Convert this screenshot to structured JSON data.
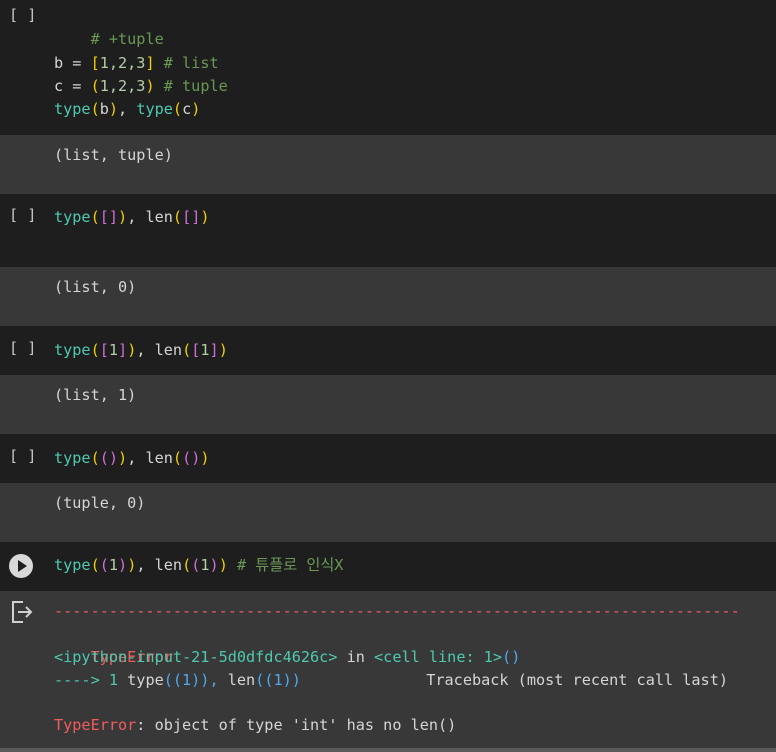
{
  "cells": {
    "c1": {
      "gutter": "[ ]",
      "l1": "# +tuple",
      "l2_a": "b = ",
      "l2_b": "[",
      "l2_c": "1,2,3",
      "l2_d": "]",
      "l2_e": " # list",
      "l3_a": "c = ",
      "l3_b": "(",
      "l3_c": "1,2,3",
      "l3_d": ")",
      "l3_e": " # tuple",
      "l4_a": "type",
      "l4_b": "(",
      "l4_c": "b",
      "l4_d": ")",
      "l4_e": ", ",
      "l4_f": "type",
      "l4_g": "(",
      "l4_h": "c",
      "l4_i": ")",
      "output": "(list, tuple)"
    },
    "c2": {
      "gutter": "[ ]",
      "a": "type",
      "b": "(",
      "c": "[]",
      "d": ")",
      "e": ", len",
      "f": "(",
      "g": "[]",
      "h": ")",
      "output": "(list, 0)"
    },
    "c3": {
      "gutter": "[ ]",
      "a": "type",
      "b": "(",
      "c": "[",
      "d": "1",
      "e": "]",
      "f": ")",
      "g": ", len",
      "h": "(",
      "i": "[",
      "j": "1",
      "k": "]",
      "l": ")",
      "output": "(list, 1)"
    },
    "c4": {
      "gutter": "[ ]",
      "a": "type",
      "b": "(",
      "c": "()",
      "d": ")",
      "e": ", len",
      "f": "(",
      "g": "()",
      "h": ")",
      "output": "(tuple, 0)"
    },
    "c5": {
      "a": "type",
      "b": "(",
      "c": "(",
      "d": "1",
      "e": ")",
      "f": ")",
      "g": ", len",
      "h": "(",
      "i": "(",
      "j": "1",
      "k": ")",
      "l": ")",
      "m": " # 튜플로 인식X"
    }
  },
  "error": {
    "dashes": "---------------------------------------------------------------------------",
    "type_name": "TypeError",
    "traceback": "Traceback (most recent call last)",
    "input_ref": "<ipython-input-21-5d0dfdc4626c>",
    "in_word": " in ",
    "cell_ref": "<cell line: 1>",
    "cell_ref_paren": "()",
    "arrow": "----> 1 ",
    "arrow_code_a": "type",
    "arrow_code_b": "((1)), ",
    "arrow_code_c": "len",
    "arrow_code_d": "((1))",
    "final_type": "TypeError",
    "final_msg": ": object of type 'int' has no len()"
  },
  "icons": {
    "run": "play-circle-icon",
    "output": "output-clear-icon"
  }
}
